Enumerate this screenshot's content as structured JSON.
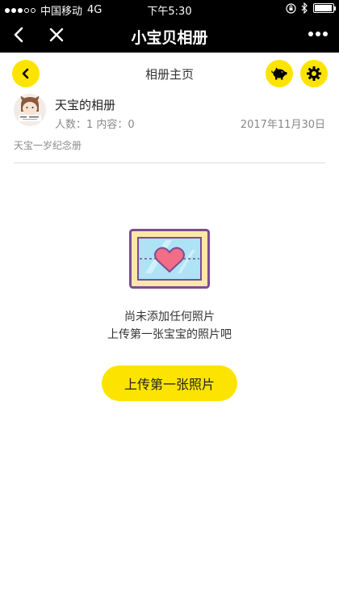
{
  "status_bar": {
    "carrier": "中国移动",
    "network": "4G",
    "time": "下午5:30",
    "battery_level": 0.95,
    "signal_bars": 3
  },
  "nav_bar": {
    "title": "小宝贝相册",
    "back_icon": "back-arrow-icon",
    "close_icon": "close-icon",
    "more_icon": "more-dots-icon"
  },
  "page_header": {
    "title": "相册主页",
    "back_icon": "chevron-left-icon",
    "piggy_icon": "piggy-bank-icon",
    "settings_icon": "gear-icon"
  },
  "album": {
    "name": "天宝的相册",
    "stats": "人数：1 内容：0",
    "date": "2017年11月30日",
    "description": "天宝一岁纪念册"
  },
  "empty_state": {
    "line1": "尚未添加任何照片",
    "line2": "上传第一张宝宝的照片吧",
    "button_label": "上传第一张照片",
    "illustration": "heart-frame-icon"
  },
  "colors": {
    "accent": "#fde400",
    "nav_background": "#000000",
    "text_primary": "#222222",
    "text_secondary": "#888888"
  }
}
